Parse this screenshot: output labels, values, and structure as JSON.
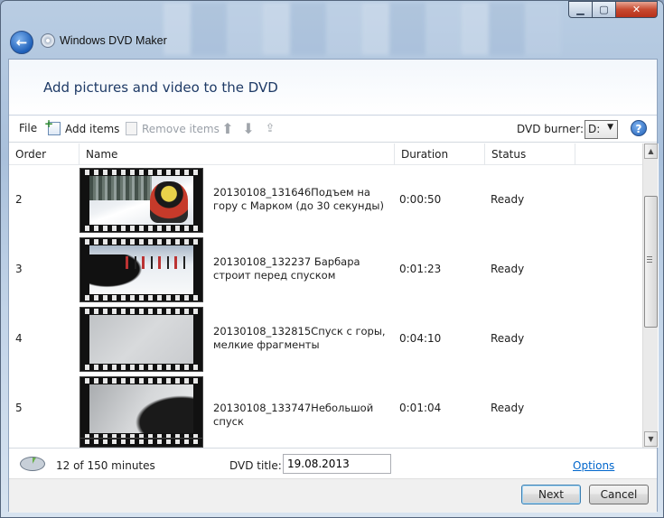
{
  "window": {
    "title": "Windows DVD Maker"
  },
  "header": {
    "title": "Add pictures and video to the DVD"
  },
  "toolbar": {
    "file": "File",
    "add_items": "Add items",
    "remove_items": "Remove items",
    "burner_label": "DVD burner:",
    "burner_value": "D:"
  },
  "columns": {
    "order": "Order",
    "name": "Name",
    "duration": "Duration",
    "status": "Status"
  },
  "rows": [
    {
      "order": "2",
      "name": "20130108_131646Подъем на гору с Марком (до 30 секунды)",
      "duration": "0:00:50",
      "status": "Ready"
    },
    {
      "order": "3",
      "name": "20130108_132237 Барбара строит перед спуском",
      "duration": "0:01:23",
      "status": "Ready"
    },
    {
      "order": "4",
      "name": "20130108_132815Спуск с горы, мелкие фрагменты",
      "duration": "0:04:10",
      "status": "Ready"
    },
    {
      "order": "5",
      "name": "20130108_133747Небольшой спуск",
      "duration": "0:01:04",
      "status": "Ready"
    }
  ],
  "footer": {
    "minutes": "12 of 150 minutes",
    "dvd_title_label": "DVD title:",
    "dvd_title_value": "19.08.2013",
    "options": "Options"
  },
  "buttons": {
    "next": "Next",
    "cancel": "Cancel"
  },
  "disc_usage_fraction": 0.08
}
